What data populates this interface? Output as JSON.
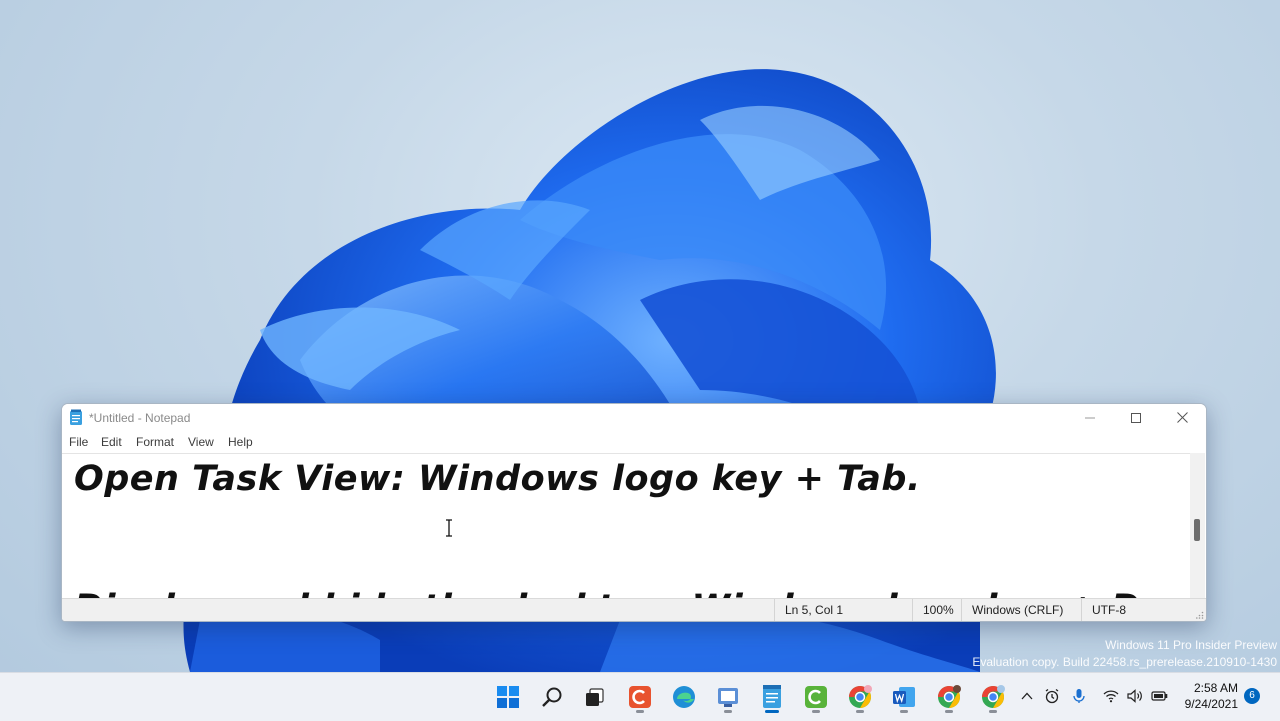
{
  "notepad": {
    "title": "*Untitled - Notepad",
    "menu": [
      "File",
      "Edit",
      "Format",
      "View",
      "Help"
    ],
    "editor": {
      "line1": "Open Task View: Windows logo key + Tab.",
      "line2": "Display and hide the desktop: Windows logo key + D."
    },
    "status": {
      "position": "Ln 5, Col 1",
      "zoom": "100%",
      "line_ending": "Windows (CRLF)",
      "encoding": "UTF-8"
    }
  },
  "watermark": {
    "line1": "Windows 11 Pro Insider Preview",
    "line2": "Evaluation copy. Build 22458.rs_prerelease.210910-1430"
  },
  "taskbar": {
    "apps": [
      "start",
      "search",
      "task-view",
      "camtasia",
      "edge",
      "paint",
      "notepad",
      "camtasia-green",
      "chrome",
      "word",
      "chrome-profile",
      "chrome-dev"
    ],
    "clock_time": "2:58 AM",
    "clock_date": "9/24/2021",
    "notification_count": "6"
  },
  "colors": {
    "accent": "#0067c0",
    "wallpaper_bloom": "#1a63e6"
  }
}
